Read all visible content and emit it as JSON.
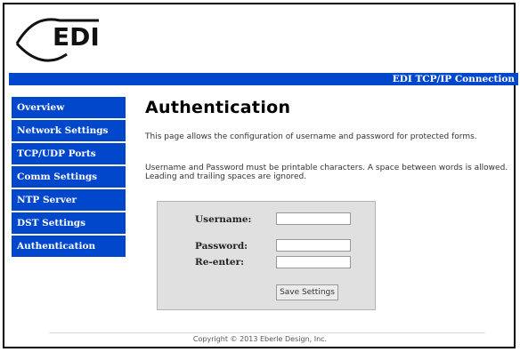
{
  "brand": {
    "logo_text": "EDI"
  },
  "banner": {
    "title": "EDI TCP/IP Connection"
  },
  "sidebar": {
    "items": [
      {
        "label": "Overview"
      },
      {
        "label": "Network Settings"
      },
      {
        "label": "TCP/UDP Ports"
      },
      {
        "label": "Comm Settings"
      },
      {
        "label": "NTP Server"
      },
      {
        "label": "DST Settings"
      },
      {
        "label": "Authentication"
      }
    ]
  },
  "main": {
    "title": "Authentication",
    "description": "This page allows the configuration of username and password for protected forms.",
    "note": "Username and Password must be printable characters. A space between words is allowed. Leading and trailing spaces are ignored."
  },
  "form": {
    "username_label": "Username:",
    "username_value": "",
    "password_label": "Password:",
    "password_value": "",
    "reenter_label": "Re-enter:",
    "reenter_value": "",
    "save_label": "Save Settings"
  },
  "footer": {
    "copyright": "Copyright © 2013 Eberle Design, Inc."
  },
  "colors": {
    "accent": "#0047cc",
    "form_bg": "#e0e0e0"
  }
}
